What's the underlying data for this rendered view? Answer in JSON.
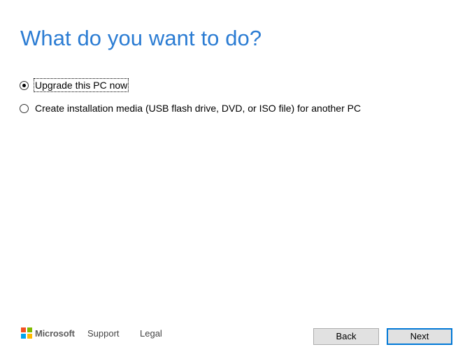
{
  "page": {
    "title": "What do you want to do?"
  },
  "options": [
    {
      "label": "Upgrade this PC now",
      "selected": true
    },
    {
      "label": "Create installation media (USB flash drive, DVD, or ISO file) for another PC",
      "selected": false
    }
  ],
  "footer": {
    "brand": "Microsoft",
    "support_label": "Support",
    "legal_label": "Legal",
    "back_label": "Back",
    "next_label": "Next"
  },
  "colors": {
    "title": "#2b7cd3",
    "next_border": "#0078d7",
    "button_bg": "#e1e1e1",
    "ms_red": "#f25022",
    "ms_green": "#7fba00",
    "ms_blue": "#00a4ef",
    "ms_yellow": "#ffb900"
  },
  "icons": {
    "brand": "microsoft-logo-icon",
    "radio_selected": "radio-checked-icon",
    "radio_unselected": "radio-unchecked-icon"
  }
}
